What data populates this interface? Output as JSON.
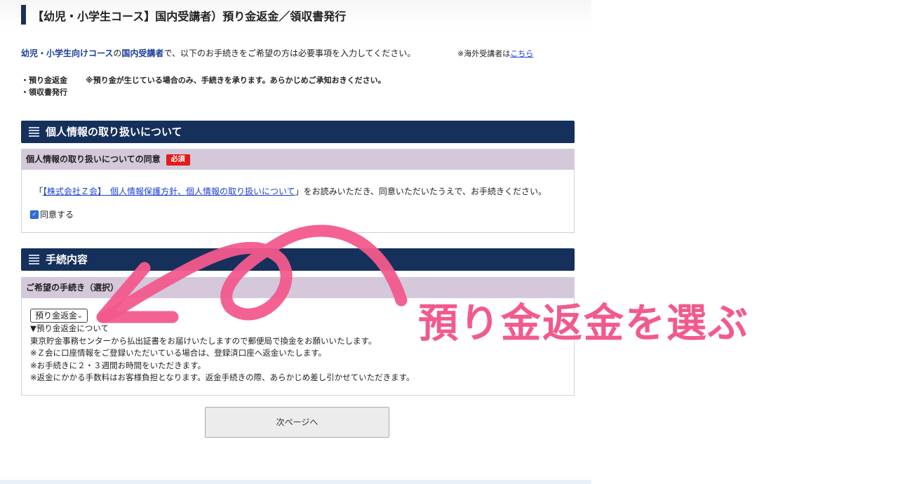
{
  "page_title": "【幼児・小学生コース】国内受講者）預り金返金／領収書発行",
  "intro": {
    "course": "幼児・小学生向けコース",
    "no": "の",
    "domestic": "国内受講者",
    "rest": "で、以下のお手続きをご希望の方は必要事項を入力してください。"
  },
  "overseas": {
    "prefix": "※海外受講者は",
    "link": "こちら"
  },
  "bullets": {
    "refund": "・預り金返金",
    "refund_note": "※預り金が生じている場合のみ、手続きを承ります。あらかじめご承知おきください。",
    "receipt": "・領収書発行"
  },
  "privacy_section": {
    "heading": "個人情報の取り扱いについて",
    "panel_label": "個人情報の取り扱いについての同意",
    "required_badge": "必須",
    "line_open": "「",
    "link_text": "【株式会社Ｚ会】　個人情報保護方針、個人情報の取り扱いについて",
    "line_close": "」をお読みいただき、同意いただいたうえで、お手続きください。",
    "agree_label": "同意する",
    "agree_checked": true
  },
  "procedure_section": {
    "heading": "手続内容",
    "panel_label": "ご希望の手続き（選択）",
    "selected": "預り金返金",
    "desc_title": "▼預り金返金について",
    "desc_lines": [
      "東京貯金事務センターから払出証書をお届けいたしますので郵便局で換金をお願いいたします。",
      "※Ｚ会に口座情報をご登録いただいている場合は、登録済口座へ返金いたします。",
      "※お手続きに２・３週間お時間をいただきます。",
      "※返金にかかる手数料はお客様負担となります。返金手続きの際、あらかじめ差し引かせていただきます。"
    ]
  },
  "next_button": "次ページへ",
  "annotation": {
    "text": "預り金返金を選ぶ",
    "color": "#f25a8c"
  },
  "colors": {
    "section_header": "#16305c",
    "panel_header": "#d4c8da",
    "required": "#e01b1b",
    "link": "#1a3fd6"
  }
}
